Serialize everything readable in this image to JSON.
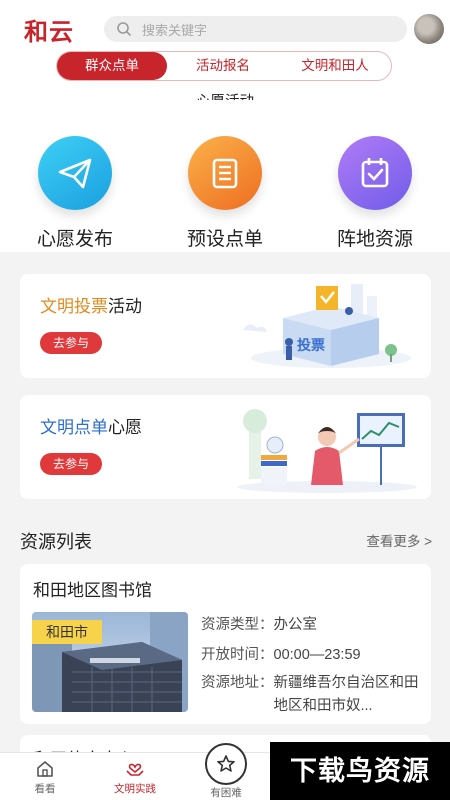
{
  "header": {
    "logo_text": "和云",
    "search_placeholder": "搜索关键字",
    "tabs": [
      {
        "label": "群众点单",
        "active": true
      },
      {
        "label": "活动报名",
        "active": false
      },
      {
        "label": "文明和田人",
        "active": false
      }
    ],
    "subtitle": "心愿活动"
  },
  "quick_actions": [
    {
      "label": "心愿发布",
      "icon": "paper-plane-icon",
      "color": "#28b7e8"
    },
    {
      "label": "预设点单",
      "icon": "list-document-icon",
      "color": "#f08a2e"
    },
    {
      "label": "阵地资源",
      "icon": "calendar-check-icon",
      "color": "#8b6cf0"
    }
  ],
  "cards": [
    {
      "title_highlight": "文明投票",
      "title_rest": "活动",
      "button": "去参与",
      "illustration_text": "投票"
    },
    {
      "title_highlight": "文明点单",
      "title_rest": "心愿",
      "button": "去参与"
    }
  ],
  "resources": {
    "title": "资源列表",
    "more": "查看更多 >",
    "items": [
      {
        "name": "和田地区图书馆",
        "tag": "和田市",
        "type_label": "资源类型：",
        "type_value": "办公室",
        "hours_label": "开放时间：",
        "hours_value": "00:00—23:59",
        "address_label": "资源地址：",
        "address_value": "新疆维吾尔自治区和田地区和田市奴..."
      },
      {
        "name": "和田体育中心"
      }
    ]
  },
  "tabbar": {
    "items": [
      {
        "label": "看看",
        "icon": "home-icon"
      },
      {
        "label": "文明实践",
        "icon": "heart-hands-icon",
        "active": true
      },
      {
        "label": "有困难",
        "icon": "star-badge-icon"
      }
    ]
  },
  "watermark": "下载鸟资源",
  "colors": {
    "brand_red": "#c8242b",
    "pill_red": "#e0393b",
    "highlight_orange": "#e38a1d",
    "highlight_blue": "#2b6ed0"
  }
}
